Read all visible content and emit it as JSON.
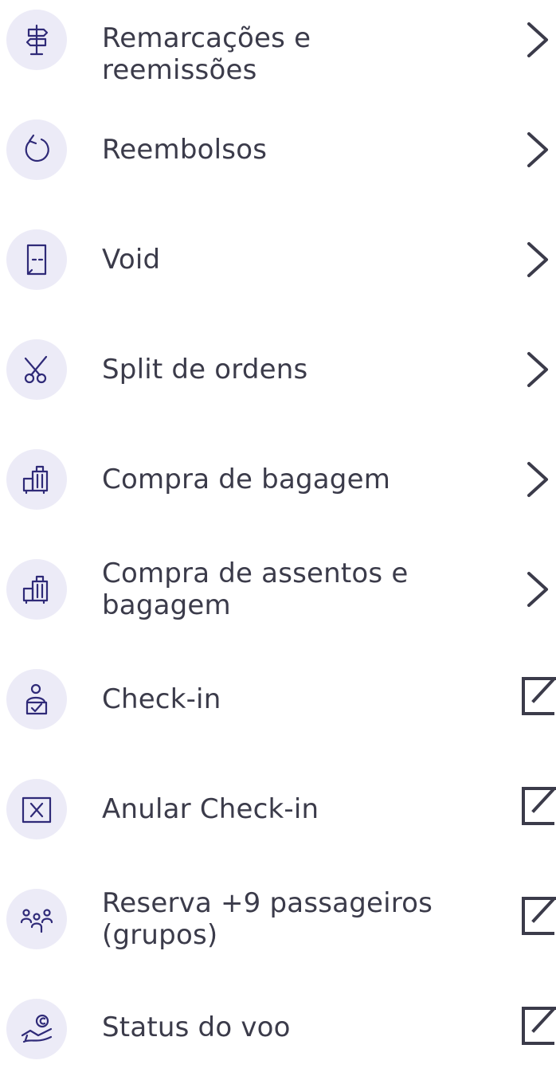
{
  "colors": {
    "icon_bg": "#ECEBF7",
    "icon_stroke": "#2F2A78",
    "text": "#3B3B4A",
    "trailing": "#3B3B4A"
  },
  "menu": {
    "items": [
      {
        "label": "Remarcações e reemissões",
        "icon": "signpost-icon",
        "trailing": "chevron-right-icon"
      },
      {
        "label": "Reembolsos",
        "icon": "refund-arrow-icon",
        "trailing": "chevron-right-icon"
      },
      {
        "label": "Void",
        "icon": "void-document-icon",
        "trailing": "chevron-right-icon"
      },
      {
        "label": "Split de ordens",
        "icon": "scissors-icon",
        "trailing": "chevron-right-icon"
      },
      {
        "label": "Compra de bagagem",
        "icon": "luggage-icon",
        "trailing": "chevron-right-icon"
      },
      {
        "label": "Compra de assentos e bagagem",
        "icon": "luggage-icon",
        "trailing": "chevron-right-icon"
      },
      {
        "label": "Check-in",
        "icon": "checkin-person-icon",
        "trailing": "external-link-icon"
      },
      {
        "label": "Anular Check-in",
        "icon": "cancel-checkin-icon",
        "trailing": "external-link-icon"
      },
      {
        "label": "Reserva +9 passageiros (grupos)",
        "icon": "group-passengers-icon",
        "trailing": "external-link-icon"
      },
      {
        "label": "Status do voo",
        "icon": "flight-status-icon",
        "trailing": "external-link-icon"
      }
    ]
  }
}
